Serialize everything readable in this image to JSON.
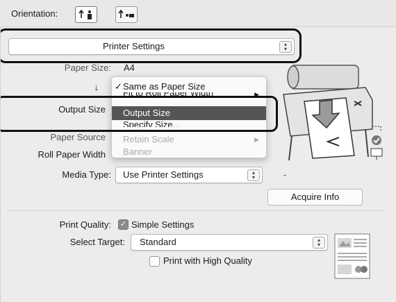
{
  "orientation": {
    "label": "Orientation:"
  },
  "printer_settings": {
    "value": "Printer Settings"
  },
  "paper_size": {
    "label": "Paper Size:",
    "value": "A4"
  },
  "reduce_enlarge": {
    "label": "↓",
    "selected": "Same as Paper Size",
    "options": [
      {
        "label": "Same as Paper Size",
        "checked": true,
        "state": "normal"
      },
      {
        "label": "Fit to Roll Paper Width",
        "state": "partial"
      },
      {
        "label": "Output Size",
        "state": "highlighted"
      },
      {
        "label": "Specify Size…",
        "state": "partial"
      },
      {
        "label": "Retain Scale",
        "state": "disabled"
      },
      {
        "label": "Banner",
        "state": "disabled"
      }
    ]
  },
  "output_size": {
    "label": "Output Size"
  },
  "paper_source": {
    "label": "Paper Source"
  },
  "roll_paper_width": {
    "label": "Roll Paper Width"
  },
  "media_type": {
    "label": "Media Type:",
    "value": "Use Printer Settings",
    "extra": "-"
  },
  "acquire_info": {
    "label": "Acquire Info"
  },
  "print_quality": {
    "label": "Print Quality:",
    "checkbox_label": "Simple Settings",
    "checked": true
  },
  "select_target": {
    "label": "Select Target:",
    "value": "Standard"
  },
  "high_quality": {
    "label": "Print with High Quality",
    "checked": false
  },
  "colors": {
    "callout": "#111111",
    "highlight": "#555555",
    "panel": "#ececec"
  }
}
